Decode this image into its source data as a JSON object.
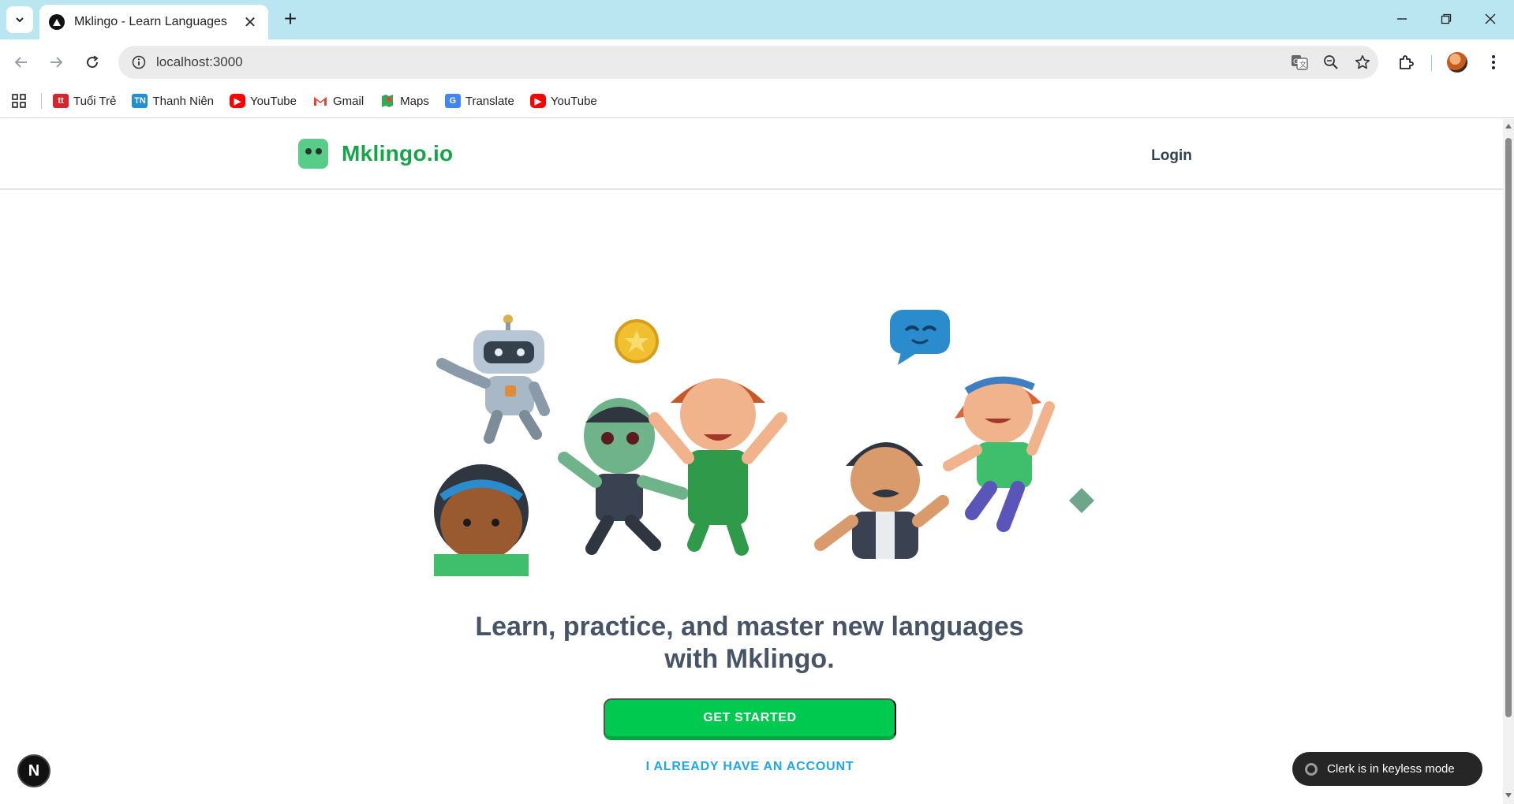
{
  "browser": {
    "tab_title": "Mklingo - Learn Languages",
    "url": "localhost:3000",
    "bookmarks": [
      {
        "label": "Tuổi Trẻ",
        "icon": "tuoitre-icon",
        "color": "#d9242b"
      },
      {
        "label": "Thanh Niên",
        "icon": "thanhnien-icon",
        "color": "#1f8fd6"
      },
      {
        "label": "YouTube",
        "icon": "youtube-icon",
        "color": "#ff0000"
      },
      {
        "label": "Gmail",
        "icon": "gmail-icon",
        "color": "#ea4335"
      },
      {
        "label": "Maps",
        "icon": "maps-icon",
        "color": "#34a853"
      },
      {
        "label": "Translate",
        "icon": "translate-icon",
        "color": "#4285f4"
      },
      {
        "label": "YouTube",
        "icon": "youtube-icon",
        "color": "#ff0000"
      }
    ]
  },
  "site": {
    "brand": "Mklingo.io",
    "login_label": "Login",
    "headline": "Learn, practice, and master new languages with Mklingo.",
    "get_started_label": "GET STARTED",
    "have_account_label": "I ALREADY HAVE AN ACCOUNT",
    "colors": {
      "brand_green": "#16a34a",
      "button_green": "#00c950",
      "link_blue": "#1ba7e8",
      "headline": "#475467"
    }
  },
  "overlays": {
    "next_badge": "N",
    "clerk_toast": "Clerk is in keyless mode"
  }
}
